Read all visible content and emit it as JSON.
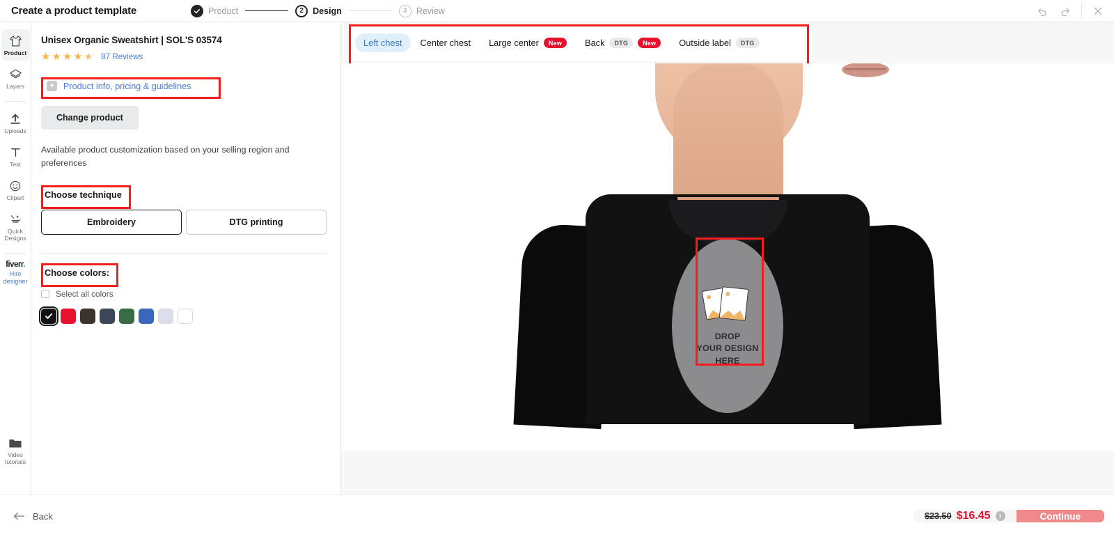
{
  "header": {
    "title": "Create a product template",
    "steps": [
      {
        "num": "",
        "label": "Product",
        "state": "done"
      },
      {
        "num": "2",
        "label": "Design",
        "state": "active"
      },
      {
        "num": "3",
        "label": "Review",
        "state": "todo"
      }
    ],
    "undo_icon": "undo-icon",
    "redo_icon": "redo-icon",
    "close_icon": "close-icon"
  },
  "rail": {
    "items": [
      {
        "label": "Product",
        "icon": "tshirt-icon",
        "selected": true
      },
      {
        "label": "Layers",
        "icon": "layers-icon",
        "selected": false
      },
      {
        "label": "Uploads",
        "icon": "upload-icon",
        "selected": false
      },
      {
        "label": "Text",
        "icon": "text-icon",
        "selected": false
      },
      {
        "label": "Clipart",
        "icon": "smiley-icon",
        "selected": false
      },
      {
        "label": "Quick Designs",
        "icon": "sparkle-icon",
        "selected": false
      }
    ],
    "fiverr_logo": "fiverr",
    "fiverr_dot": ".",
    "fiverr_link": "Hire designer",
    "video_tutorials": "Video tutorials"
  },
  "panel": {
    "product_title": "Unisex Organic Sweatshirt | SOL'S 03574",
    "rating": 4.5,
    "stars": [
      "full",
      "full",
      "full",
      "full",
      "half"
    ],
    "reviews": "87 Reviews",
    "info_link": "Product info, pricing & guidelines",
    "info_badge_icon": "plus-diamond-icon",
    "change_product": "Change product",
    "availability_note": "Available product customization based on your selling region and preferences",
    "technique_label": "Choose technique",
    "techniques": [
      {
        "label": "Embroidery",
        "selected": true
      },
      {
        "label": "DTG printing",
        "selected": false
      }
    ],
    "colors_label": "Choose colors:",
    "select_all_label": "Select all colors",
    "select_all_checked": false,
    "swatches": [
      {
        "name": "black",
        "hex": "#121213",
        "selected": true
      },
      {
        "name": "red",
        "hex": "#e8112d",
        "selected": false
      },
      {
        "name": "dark-brown",
        "hex": "#3c332e",
        "selected": false
      },
      {
        "name": "navy-slate",
        "hex": "#3b4656",
        "selected": false
      },
      {
        "name": "forest-green",
        "hex": "#366b44",
        "selected": false
      },
      {
        "name": "royal-blue",
        "hex": "#3868bb",
        "selected": false
      },
      {
        "name": "light-lavender",
        "hex": "#dcdcea",
        "selected": false
      },
      {
        "name": "white",
        "hex": "#ffffff",
        "selected": false
      }
    ]
  },
  "canvas": {
    "tabs": [
      {
        "label": "Left chest",
        "active": true,
        "badges": []
      },
      {
        "label": "Center chest",
        "active": false,
        "badges": []
      },
      {
        "label": "Large center",
        "active": false,
        "badges": [
          {
            "text": "New",
            "kind": "new"
          }
        ]
      },
      {
        "label": "Back",
        "active": false,
        "badges": [
          {
            "text": "DTG",
            "kind": "dtg"
          },
          {
            "text": "New",
            "kind": "new"
          }
        ]
      },
      {
        "label": "Outside label",
        "active": false,
        "badges": [
          {
            "text": "DTG",
            "kind": "dtg"
          }
        ]
      }
    ],
    "dropzone": {
      "line1": "DROP",
      "line2": "YOUR DESIGN",
      "line3": "HERE",
      "icon": "photos-icon"
    },
    "mockup_alt": "Model wearing black unisex organic sweatshirt"
  },
  "footer": {
    "back_label": "Back",
    "back_icon": "arrow-left-icon",
    "price_old": "$23.50",
    "price_new": "$16.45",
    "info_icon": "info-icon",
    "continue_label": "Continue"
  },
  "colors": {
    "highlight": "#f41c1c",
    "accent_blue": "#4a7fd4",
    "badge_red": "#e8112d",
    "cta": "#f08a8a",
    "star": "#f5b74e"
  }
}
